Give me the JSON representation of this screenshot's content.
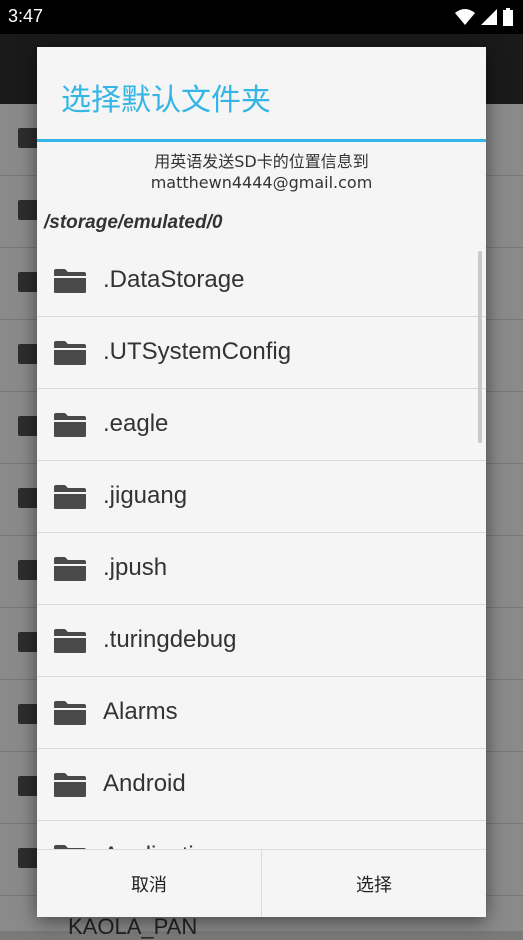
{
  "status_bar": {
    "time": "3:47"
  },
  "background": {
    "partial_row_label": "KAOLA_PAN"
  },
  "dialog": {
    "title": "选择默认文件夹",
    "message_line1": "用英语发送SD卡的位置信息到",
    "message_line2": "matthewn4444@gmail.com",
    "current_path": "/storage/emulated/0",
    "folders": [
      ".DataStorage",
      ".UTSystemConfig",
      ".eagle",
      ".jiguang",
      ".jpush",
      ".turingdebug",
      "Alarms",
      "Android",
      "Applications"
    ],
    "cancel_label": "取消",
    "select_label": "选择"
  },
  "colors": {
    "accent": "#33b5e5",
    "folder_icon": "#4a4a4a"
  }
}
